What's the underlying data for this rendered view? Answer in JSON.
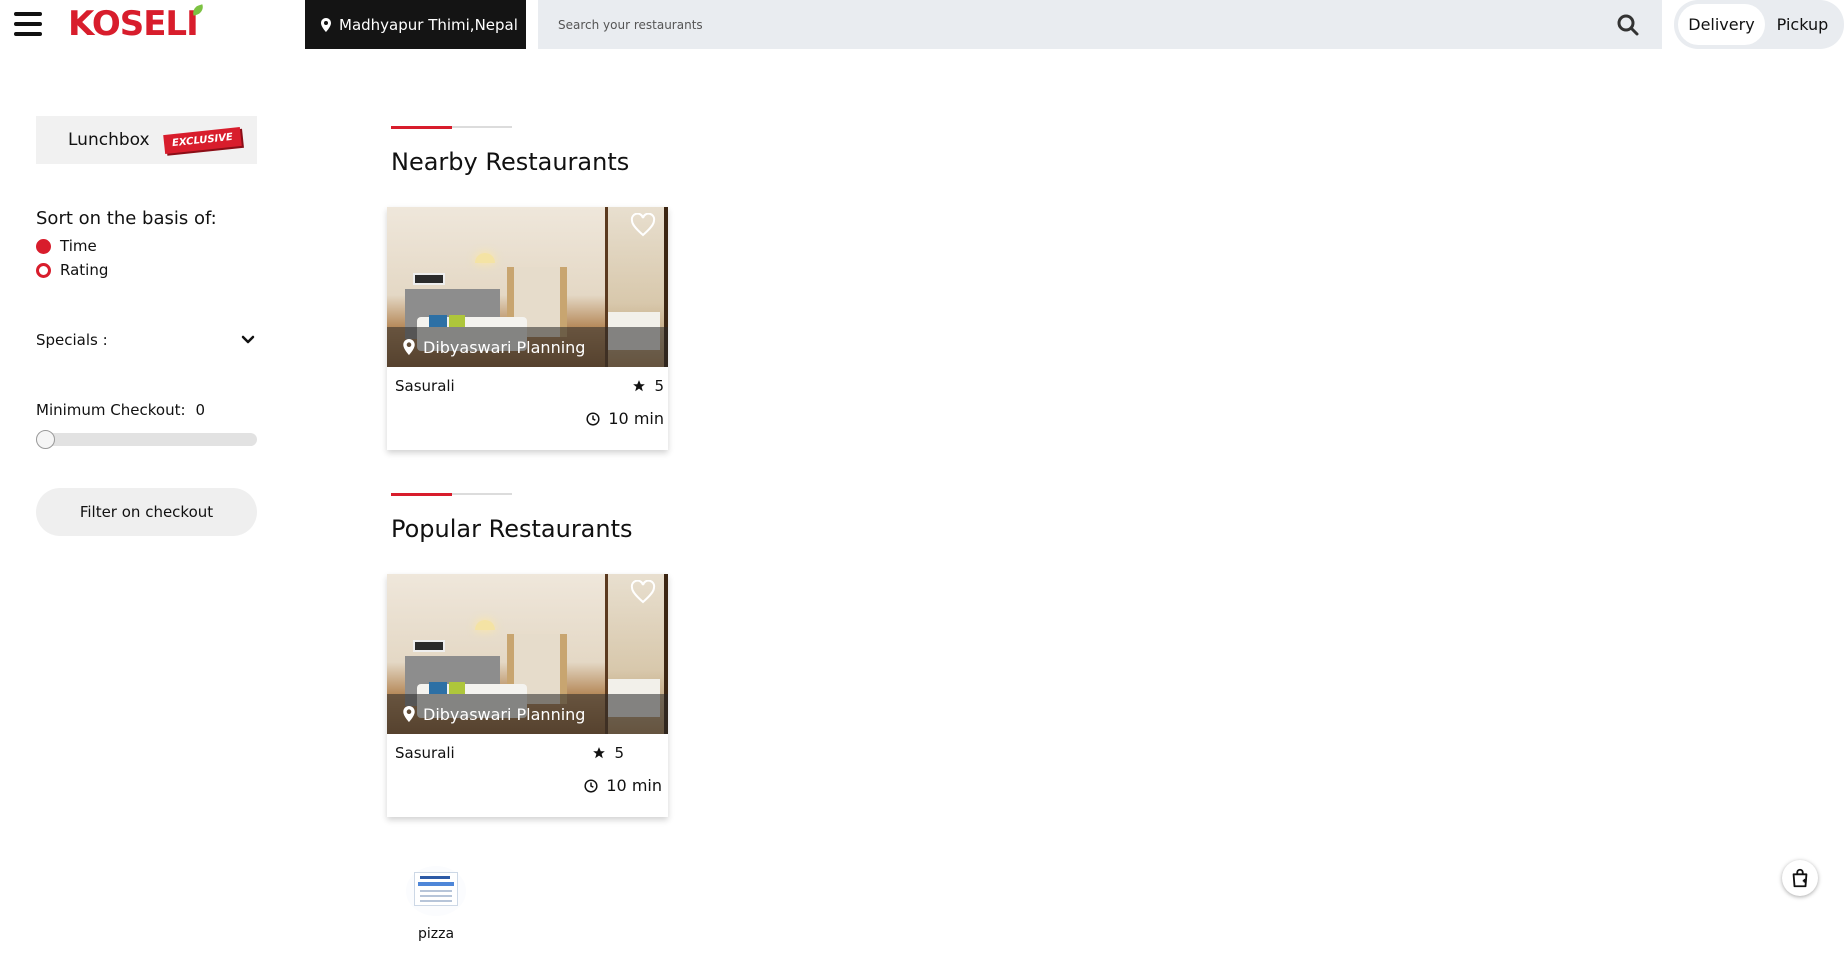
{
  "brand": {
    "logo_text": "KOSELI",
    "primary_color": "#d81d2c",
    "accent_color": "#7cc242"
  },
  "header": {
    "location": "Madhyapur Thimi,Nepal",
    "search_placeholder": "Search your restaurants",
    "modes": [
      {
        "label": "Delivery",
        "selected": true
      },
      {
        "label": "Pickup",
        "selected": false
      }
    ]
  },
  "sidebar": {
    "lunchbox_label": "Lunchbox",
    "lunchbox_badge": "EXCLUSIVE",
    "sort_title": "Sort on the basis of:",
    "sort_options": [
      {
        "label": "Time",
        "selected": true
      },
      {
        "label": "Rating",
        "selected": false
      }
    ],
    "specials_label": "Specials :",
    "min_checkout_label": "Minimum Checkout:",
    "min_checkout_value": "0",
    "min_checkout_slider_fraction": 0,
    "filter_button": "Filter on checkout"
  },
  "sections": [
    {
      "title": "Nearby Restaurants",
      "cards": [
        {
          "location": "Dibyaswari Planning",
          "name": "Sasurali",
          "rating": "5",
          "time": "10 min"
        }
      ]
    },
    {
      "title": "Popular Restaurants",
      "cards": [
        {
          "location": "Dibyaswari Planning",
          "name": "Sasurali",
          "rating": "5",
          "time": "10 min"
        }
      ]
    }
  ],
  "categories": [
    {
      "label": "pizza",
      "icon": "certificate-image"
    }
  ],
  "floating": {
    "cart_icon": "shopping-bag-icon"
  }
}
